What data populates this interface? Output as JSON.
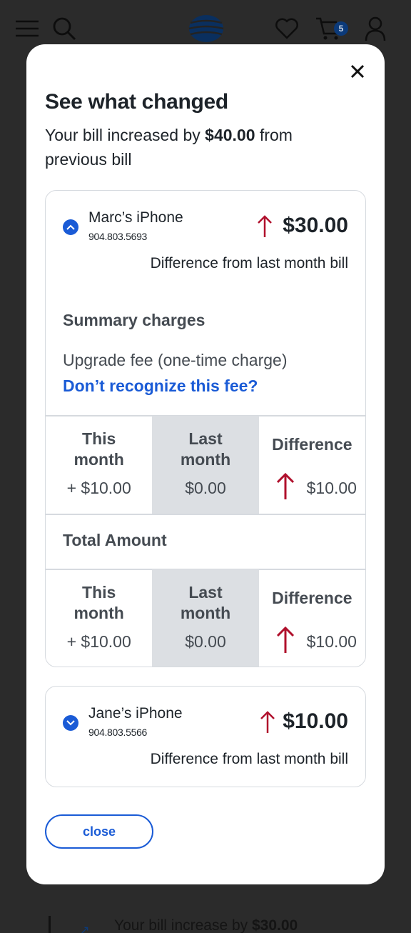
{
  "header": {
    "icons": [
      "menu-icon",
      "search-icon",
      "att-globe-logo",
      "heart-icon",
      "cart-icon",
      "user-icon"
    ],
    "cart_count": "5"
  },
  "background": {
    "peek_text_prefix": "Your bill increase by ",
    "peek_text_amount": "$30.00"
  },
  "modal": {
    "title": "See what changed",
    "subtitle_prefix": "Your bill increased by ",
    "subtitle_amount": "$40.00",
    "subtitle_suffix": " from previous bill",
    "close_label": "close",
    "lines": [
      {
        "name": "Marc’s iPhone",
        "number": "904.803.5693",
        "amount": "$30.00",
        "diff_label": "Difference from last month bill",
        "expanded": true,
        "summary_heading": "Summary charges",
        "fee_label": "Upgrade fee (one-time charge)",
        "fee_link": "Don’t recognize this fee?",
        "charge_table": {
          "this_month_label": "This month",
          "last_month_label": "Last month",
          "difference_label": "Difference",
          "this_month_value": "+ $10.00",
          "last_month_value": "$0.00",
          "difference_value": "$10.00"
        },
        "total_heading": "Total Amount",
        "total_table": {
          "this_month_label": "This month",
          "last_month_label": "Last month",
          "difference_label": "Difference",
          "this_month_value": "+ $10.00",
          "last_month_value": "$0.00",
          "difference_value": "$10.00"
        }
      },
      {
        "name": "Jane’s iPhone",
        "number": "904.803.5566",
        "amount": "$10.00",
        "diff_label": "Difference from last month bill",
        "expanded": false
      }
    ]
  },
  "colors": {
    "accent_blue": "#1a5bd6",
    "increase_red": "#b0102c",
    "overlay": "#2b2b2b"
  }
}
